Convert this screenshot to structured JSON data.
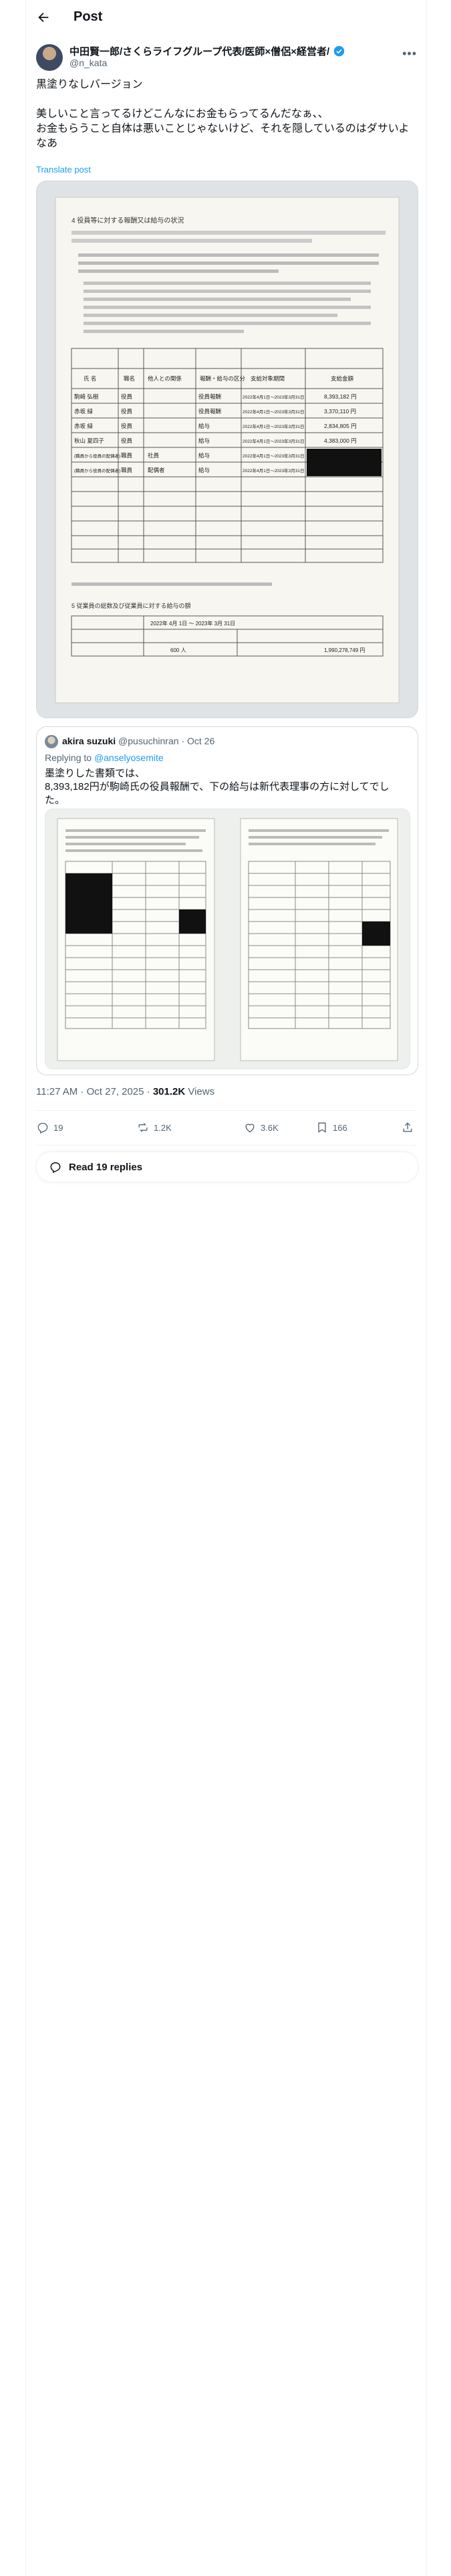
{
  "header": {
    "title": "Post"
  },
  "author": {
    "name": "中田賢一郎/さくらライフグループ代表/医師×僧侶×経営者/",
    "handle": "@n_kata"
  },
  "post": {
    "lines": [
      "黒塗りなしバージョン",
      "",
      "美しいこと言ってるけどこんなにお金もらってるんだなぁ、、",
      "お金もらうこと自体は悪いことじゃないけど、それを隠しているのはダサいよなあ"
    ],
    "translate_label": "Translate post"
  },
  "document": {
    "heading": "4  役員等に対する報酬又は給与の状況",
    "table_headers": [
      "氏 名",
      "職名",
      "他人との関係",
      "報酬・給与の区分",
      "支給対象期間",
      "支給金額"
    ],
    "rows": [
      {
        "name": "駒崎 弘樹",
        "title": "役員",
        "relation": "",
        "type": "役員報酬",
        "period": "2022年4月1日〜2023年3月31日",
        "amount": "8,393,182 円"
      },
      {
        "name": "赤坂 緑",
        "title": "役員",
        "relation": "",
        "type": "役員報酬",
        "period": "2022年4月1日〜2023年3月31日",
        "amount": "3,370,110 円"
      },
      {
        "name": "赤坂 緑",
        "title": "役員",
        "relation": "",
        "type": "給与",
        "period": "2022年4月1日〜2023年3月31日",
        "amount": "2,834,805 円"
      },
      {
        "name": "秋山 夏四子",
        "title": "役員",
        "relation": "",
        "type": "給与",
        "period": "2022年4月1日〜2023年3月31日",
        "amount": "4,383,000 円"
      },
      {
        "name": "(職員から役員の配偶者)",
        "title": "職員",
        "relation": "社員",
        "type": "給与",
        "period": "2022年4月1日〜2023年3月31日",
        "amount": ""
      },
      {
        "name": "(職員から役員の配偶者)",
        "title": "職員",
        "relation": "配偶者",
        "type": "給与",
        "period": "2022年4月1日〜2023年3月31日",
        "amount": ""
      }
    ],
    "total_section": "5  従業員の総数及び従業員に対する給与の額",
    "fiscal_year": "2022年 4月 1日 〜 2023年 3月 31日",
    "employee_count": "600 人",
    "total_salary": "1,990,278,749 円"
  },
  "quote": {
    "name": "akira suzuki",
    "handle": "@pusuchinran",
    "date": "Oct 26",
    "replying_prefix": "Replying to ",
    "replying_to": "@anselyosemite",
    "lines": [
      "墨塗りした書類では、",
      "8,393,182円が駒崎氏の役員報酬で、下の給与は新代表理事の方に対してでした。"
    ]
  },
  "meta": {
    "time": "11:27 AM · Oct 27, 2025 · ",
    "views_count": "301.2K",
    "views_label": " Views"
  },
  "actions": {
    "replies": "19",
    "reposts": "1.2K",
    "likes": "3.6K",
    "bookmarks": "166"
  },
  "read_replies_label": "Read 19 replies",
  "colors": {
    "accent": "#1d9bf0",
    "muted": "#536471",
    "text": "#0f1419",
    "border": "#cfd9de"
  }
}
